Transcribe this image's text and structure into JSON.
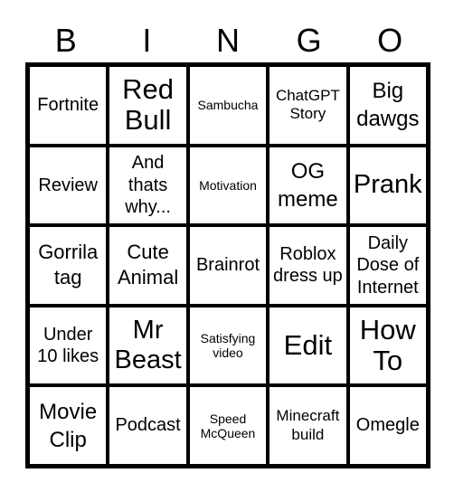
{
  "header": {
    "letters": [
      "B",
      "I",
      "N",
      "G",
      "O"
    ]
  },
  "board": {
    "rows": [
      [
        "Fortnite",
        "Red Bull",
        "Sambucha",
        "ChatGPT Story",
        "Big dawgs"
      ],
      [
        "Review",
        "And thats why...",
        "Motivation",
        "OG meme",
        "Prank"
      ],
      [
        "Gorrila tag",
        "Cute Animal",
        "Brainrot",
        "Roblox dress up",
        "Daily Dose of Internet"
      ],
      [
        "Under 10 likes",
        "Mr Beast",
        "Satisfying video",
        "Edit",
        "How To"
      ],
      [
        "Movie Clip",
        "Podcast",
        "Speed McQueen",
        "Minecraft build",
        "Omegle"
      ]
    ]
  }
}
